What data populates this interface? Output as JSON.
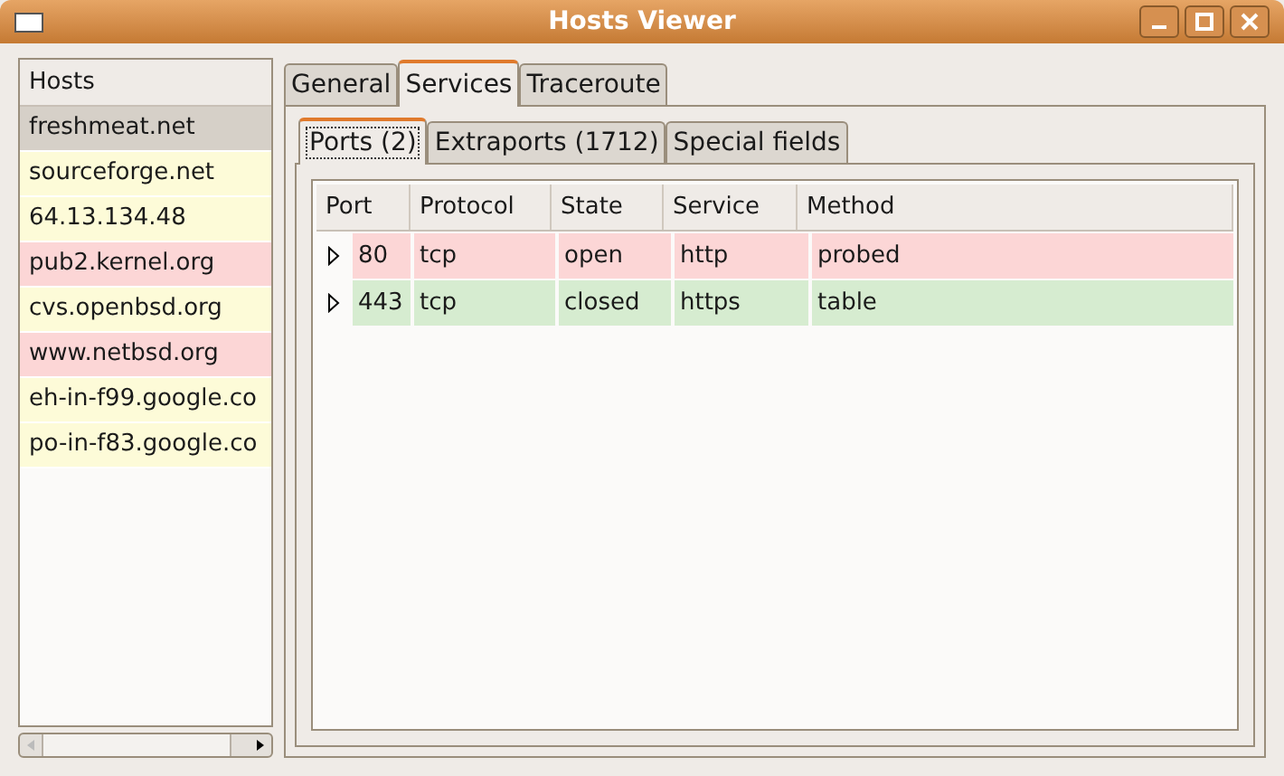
{
  "window": {
    "title": "Hosts Viewer"
  },
  "hosts": {
    "heading": "Hosts",
    "items": [
      {
        "name": "freshmeat.net",
        "selected": true
      },
      {
        "name": "sourceforge.net",
        "selected": false,
        "color": "#fdfbd8"
      },
      {
        "name": "64.13.134.48",
        "selected": false,
        "color": "#fdfbd8"
      },
      {
        "name": "pub2.kernel.org",
        "selected": false,
        "color": "#fcd6d6"
      },
      {
        "name": "cvs.openbsd.org",
        "selected": false,
        "color": "#fdfbd8"
      },
      {
        "name": "www.netbsd.org",
        "selected": false,
        "color": "#fcd6d6"
      },
      {
        "name": "eh-in-f99.google.co",
        "selected": false,
        "color": "#fdfbd8"
      },
      {
        "name": "po-in-f83.google.co",
        "selected": false,
        "color": "#fdfbd8"
      }
    ]
  },
  "tabs": [
    {
      "label": "General",
      "selected": false
    },
    {
      "label": "Services",
      "selected": true
    },
    {
      "label": "Traceroute",
      "selected": false
    }
  ],
  "subtabs": [
    {
      "label": "Ports (2)",
      "selected": true
    },
    {
      "label": "Extraports (1712)",
      "selected": false
    },
    {
      "label": "Special fields",
      "selected": false
    }
  ],
  "table": {
    "columns": [
      "Port",
      "Protocol",
      "State",
      "Service",
      "Method"
    ],
    "rows": [
      {
        "cells": [
          "80",
          "tcp",
          "open",
          "http",
          "probed"
        ],
        "color": "#fcd6d6"
      },
      {
        "cells": [
          "443",
          "tcp",
          "closed",
          "https",
          "table"
        ],
        "color": "#d6ecd0"
      }
    ]
  }
}
